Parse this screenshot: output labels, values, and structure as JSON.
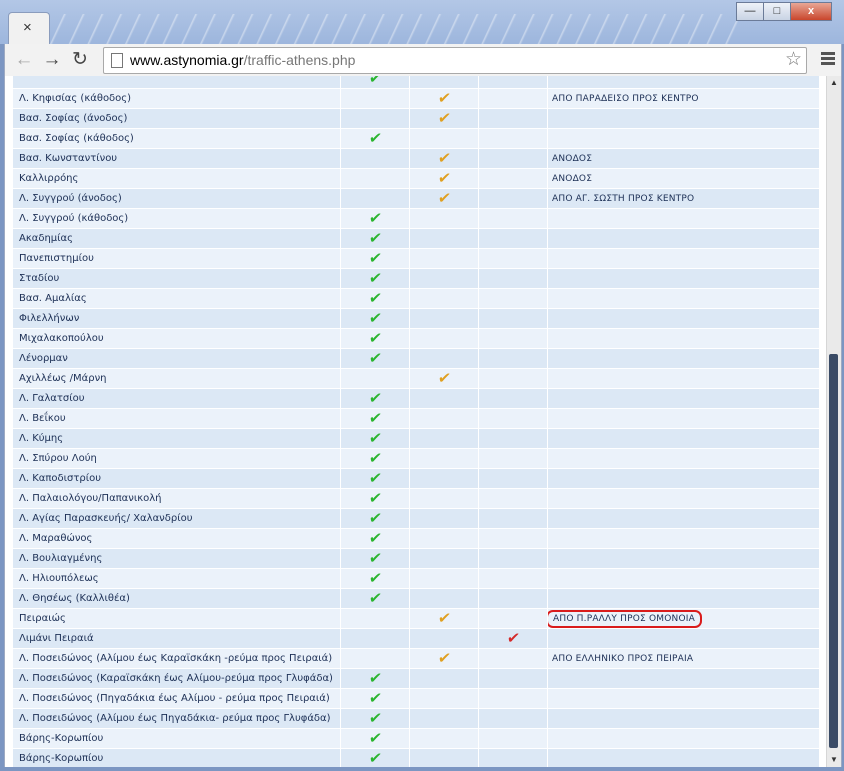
{
  "browser": {
    "tab_close": "×",
    "url_host": "www.astynomia.gr",
    "url_path": "/traffic-athens.php",
    "controls": {
      "minimize": "—",
      "maximize": "□",
      "close": "x"
    }
  },
  "colors": {
    "green_check": "#2ab52f",
    "orange_check": "#e0a020",
    "red_check": "#d42a2a",
    "highlight": "#d91c1c"
  },
  "rows": [
    {
      "road": "",
      "c1": "green",
      "c2": "",
      "c3": "",
      "note": ""
    },
    {
      "road": "Λ. Κηφισίας (κάθοδος)",
      "c1": "",
      "c2": "orange",
      "c3": "",
      "note": "ΑΠΟ ΠΑΡΑΔΕΙΣΟ ΠΡΟΣ ΚΕΝΤΡΟ"
    },
    {
      "road": "Βασ. Σοφίας (άνοδος)",
      "c1": "",
      "c2": "orange",
      "c3": "",
      "note": ""
    },
    {
      "road": "Βασ. Σοφίας (κάθοδος)",
      "c1": "green",
      "c2": "",
      "c3": "",
      "note": ""
    },
    {
      "road": "Βασ. Κωνσταντίνου",
      "c1": "",
      "c2": "orange",
      "c3": "",
      "note": "ΑΝΟΔΟΣ"
    },
    {
      "road": "Καλλιρρόης",
      "c1": "",
      "c2": "orange",
      "c3": "",
      "note": "ΑΝΟΔΟΣ"
    },
    {
      "road": "Λ. Συγγρού (άνοδος)",
      "c1": "",
      "c2": "orange",
      "c3": "",
      "note": "ΑΠΟ ΑΓ. ΣΩΣΤΗ ΠΡΟΣ ΚΕΝΤΡΟ"
    },
    {
      "road": "Λ. Συγγρού (κάθοδος)",
      "c1": "green",
      "c2": "",
      "c3": "",
      "note": ""
    },
    {
      "road": "Ακαδημίας",
      "c1": "green",
      "c2": "",
      "c3": "",
      "note": ""
    },
    {
      "road": "Πανεπιστημίου",
      "c1": "green",
      "c2": "",
      "c3": "",
      "note": ""
    },
    {
      "road": "Σταδίου",
      "c1": "green",
      "c2": "",
      "c3": "",
      "note": ""
    },
    {
      "road": "Βασ. Αμαλίας",
      "c1": "green",
      "c2": "",
      "c3": "",
      "note": ""
    },
    {
      "road": "Φιλελλήνων",
      "c1": "green",
      "c2": "",
      "c3": "",
      "note": ""
    },
    {
      "road": "Μιχαλακοπούλου",
      "c1": "green",
      "c2": "",
      "c3": "",
      "note": ""
    },
    {
      "road": "Λένορμαν",
      "c1": "green",
      "c2": "",
      "c3": "",
      "note": ""
    },
    {
      "road": "Αχιλλέως /Μάρνη",
      "c1": "",
      "c2": "orange",
      "c3": "",
      "note": ""
    },
    {
      "road": "Λ. Γαλατσίου",
      "c1": "green",
      "c2": "",
      "c3": "",
      "note": ""
    },
    {
      "road": "Λ. Βεΐκου",
      "c1": "green",
      "c2": "",
      "c3": "",
      "note": ""
    },
    {
      "road": "Λ. Κύμης",
      "c1": "green",
      "c2": "",
      "c3": "",
      "note": ""
    },
    {
      "road": "Λ. Σπύρου Λούη",
      "c1": "green",
      "c2": "",
      "c3": "",
      "note": ""
    },
    {
      "road": "Λ. Καποδιστρίου",
      "c1": "green",
      "c2": "",
      "c3": "",
      "note": ""
    },
    {
      "road": "Λ. Παλαιολόγου/Παπανικολή",
      "c1": "green",
      "c2": "",
      "c3": "",
      "note": ""
    },
    {
      "road": "Λ. Αγίας Παρασκευής/ Χαλανδρίου",
      "c1": "green",
      "c2": "",
      "c3": "",
      "note": ""
    },
    {
      "road": "Λ. Μαραθώνος",
      "c1": "green",
      "c2": "",
      "c3": "",
      "note": ""
    },
    {
      "road": "Λ. Βουλιαγμένης",
      "c1": "green",
      "c2": "",
      "c3": "",
      "note": ""
    },
    {
      "road": "Λ. Ηλιουπόλεως",
      "c1": "green",
      "c2": "",
      "c3": "",
      "note": ""
    },
    {
      "road": "Λ. Θησέως (Καλλιθέα)",
      "c1": "green",
      "c2": "",
      "c3": "",
      "note": ""
    },
    {
      "road": "Πειραιώς",
      "c1": "",
      "c2": "orange",
      "c3": "",
      "note": "ΑΠΟ Π.ΡΑΛΛΥ ΠΡΟΣ ΟΜΟΝΟΙΑ",
      "highlight": true
    },
    {
      "road": "Λιμάνι Πειραιά",
      "c1": "",
      "c2": "",
      "c3": "red",
      "note": ""
    },
    {
      "road": "Λ. Ποσειδώνος (Αλίμου έως Καραϊσκάκη -ρεύμα προς Πειραιά)",
      "c1": "",
      "c2": "orange",
      "c3": "",
      "note": "ΑΠΟ ΕΛΛΗΝΙΚΟ ΠΡΟΣ ΠΕΙΡΑΙΑ"
    },
    {
      "road": "Λ. Ποσειδώνος (Καραϊσκάκη έως Αλίμου-ρεύμα προς Γλυφάδα)",
      "c1": "green",
      "c2": "",
      "c3": "",
      "note": ""
    },
    {
      "road": "Λ. Ποσειδώνος (Πηγαδάκια έως Αλίμου - ρεύμα προς Πειραιά)",
      "c1": "green",
      "c2": "",
      "c3": "",
      "note": ""
    },
    {
      "road": "Λ. Ποσειδώνος (Αλίμου έως Πηγαδάκια- ρεύμα προς Γλυφάδα)",
      "c1": "green",
      "c2": "",
      "c3": "",
      "note": ""
    },
    {
      "road": "Βάρης-Κορωπίου",
      "c1": "green",
      "c2": "",
      "c3": "",
      "note": ""
    },
    {
      "road": "Βάρης-Κορωπίου",
      "c1": "green",
      "c2": "",
      "c3": "",
      "note": ""
    }
  ]
}
